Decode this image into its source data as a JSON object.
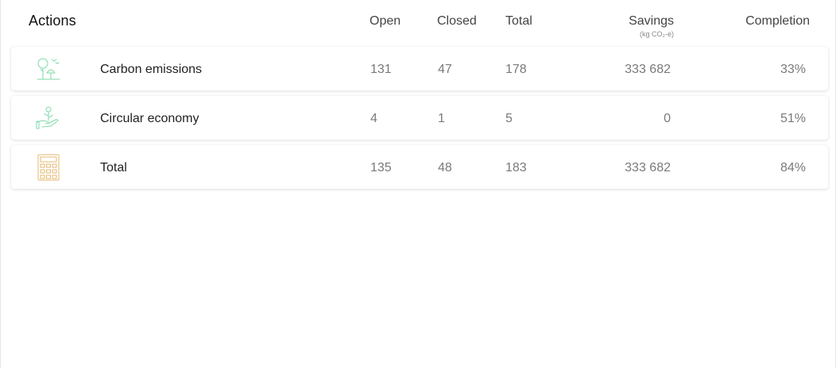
{
  "header": {
    "title": "Actions",
    "columns": {
      "open": "Open",
      "closed": "Closed",
      "total": "Total",
      "savings": "Savings",
      "savings_unit": "(kg CO₂-e)",
      "completion": "Completion"
    }
  },
  "rows": [
    {
      "icon": "tree-landscape-icon",
      "icon_color": "#7ed9a8",
      "label": "Carbon emissions",
      "open": "131",
      "closed": "47",
      "total": "178",
      "savings": "333 682",
      "completion": "33%"
    },
    {
      "icon": "hand-plant-icon",
      "icon_color": "#7ed9a8",
      "label": "Circular economy",
      "open": "4",
      "closed": "1",
      "total": "5",
      "savings": "0",
      "completion": "51%"
    },
    {
      "icon": "calculator-icon",
      "icon_color": "#e5b870",
      "label": "Total",
      "open": "135",
      "closed": "48",
      "total": "183",
      "savings": "333 682",
      "completion": "84%"
    }
  ]
}
